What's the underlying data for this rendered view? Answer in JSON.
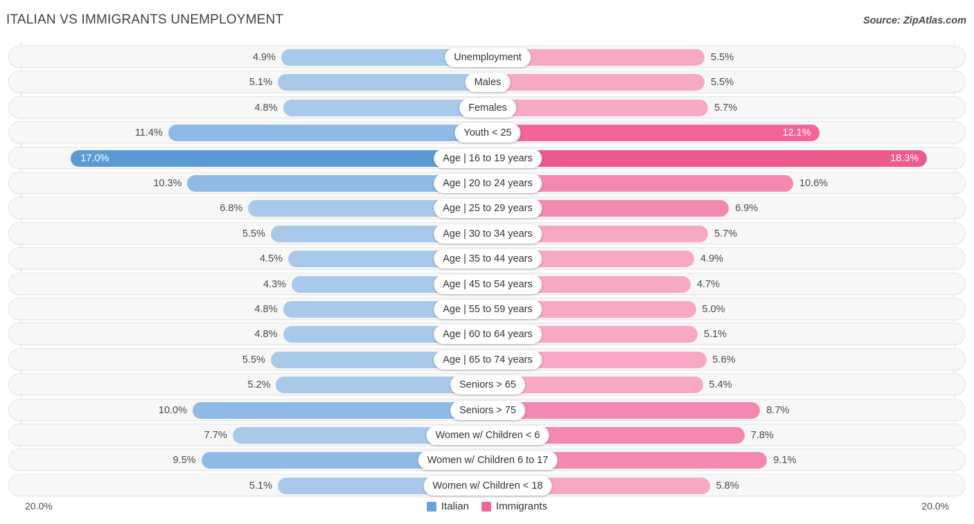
{
  "header": {
    "title": "ITALIAN VS IMMIGRANTS UNEMPLOYMENT",
    "source": "Source: ZipAtlas.com"
  },
  "axis": {
    "left_label": "20.0%",
    "right_label": "20.0%"
  },
  "legend": {
    "items": [
      {
        "label": "Italian",
        "color": "#6aa2dc"
      },
      {
        "label": "Immigrants",
        "color": "#f2649a"
      }
    ]
  },
  "colors": {
    "blue_light": "#a9c9ea",
    "blue_mid": "#8fbae5",
    "blue_dark": "#5b9bd5",
    "pink_light": "#f7a8c4",
    "pink_mid": "#f389b0",
    "pink_dark": "#f2649a",
    "pink_darkest": "#ee5a8e",
    "track": "#f7f7f7",
    "grid": "#e2e2e2"
  },
  "chart_data": {
    "type": "bar",
    "title": "ITALIAN VS IMMIGRANTS UNEMPLOYMENT",
    "subtitle": "",
    "xlabel": "",
    "ylabel": "",
    "orientation": "horizontal-diverging",
    "axis_max": 20.0,
    "axis_unit": "%",
    "grid": true,
    "legend_position": "bottom-center",
    "categories": [
      "Unemployment",
      "Males",
      "Females",
      "Youth < 25",
      "Age | 16 to 19 years",
      "Age | 20 to 24 years",
      "Age | 25 to 29 years",
      "Age | 30 to 34 years",
      "Age | 35 to 44 years",
      "Age | 45 to 54 years",
      "Age | 55 to 59 years",
      "Age | 60 to 64 years",
      "Age | 65 to 74 years",
      "Seniors > 65",
      "Seniors > 75",
      "Women w/ Children < 6",
      "Women w/ Children 6 to 17",
      "Women w/ Children < 18"
    ],
    "series": [
      {
        "name": "Italian",
        "color": "#6aa2dc",
        "values": [
          4.9,
          5.1,
          4.8,
          11.4,
          17.0,
          10.3,
          6.8,
          5.5,
          4.5,
          4.3,
          4.8,
          4.8,
          5.5,
          5.2,
          10.0,
          7.7,
          9.5,
          5.1
        ],
        "labels": [
          "4.9%",
          "5.1%",
          "4.8%",
          "11.4%",
          "17.0%",
          "10.3%",
          "6.8%",
          "5.5%",
          "4.5%",
          "4.3%",
          "4.8%",
          "4.8%",
          "5.5%",
          "5.2%",
          "10.0%",
          "7.7%",
          "9.5%",
          "5.1%"
        ]
      },
      {
        "name": "Immigrants",
        "color": "#f2649a",
        "values": [
          5.5,
          5.5,
          5.7,
          12.1,
          18.3,
          10.6,
          6.9,
          5.7,
          4.9,
          4.7,
          5.0,
          5.1,
          5.6,
          5.4,
          8.7,
          7.8,
          9.1,
          5.8
        ],
        "labels": [
          "5.5%",
          "5.5%",
          "5.7%",
          "12.1%",
          "18.3%",
          "10.6%",
          "6.9%",
          "5.7%",
          "4.9%",
          "4.7%",
          "5.0%",
          "5.1%",
          "5.6%",
          "5.4%",
          "8.7%",
          "7.8%",
          "9.1%",
          "5.8%"
        ]
      }
    ]
  }
}
